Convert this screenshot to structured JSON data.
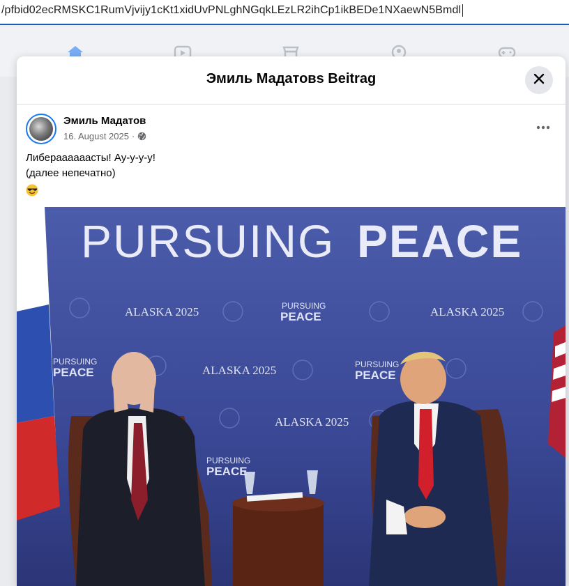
{
  "browser": {
    "url_fragment": "/pfbid02ecRMSKC1RumVjvijy1cKt1xidUvPNLghNGqkLEzLR2ihCp1ikBEDe1NXaewN5Bmdl"
  },
  "nav": {
    "icons": [
      "home-icon",
      "video-icon",
      "marketplace-icon",
      "groups-icon",
      "gaming-icon"
    ],
    "active_color": "#1877f2"
  },
  "modal": {
    "title": "Эмиль Мадатовs Beitrag"
  },
  "post": {
    "author": "Эмиль Мадатов",
    "date": "16. August 2025",
    "separator": "·",
    "lines": [
      "Либераааааасты! Ау-у-у-у!",
      "(далее непечатно)"
    ],
    "emoji": "sunglasses-emoji"
  },
  "photo": {
    "headline_light": "PURSUING",
    "headline_bold": "PEACE",
    "backdrop_small_1": "ALASKA 2025",
    "backdrop_small_2": "PURSUING",
    "backdrop_small_3": "PEACE"
  },
  "colors": {
    "accent": "#1877f2",
    "backdrop_blue": "#3d4c9c"
  }
}
